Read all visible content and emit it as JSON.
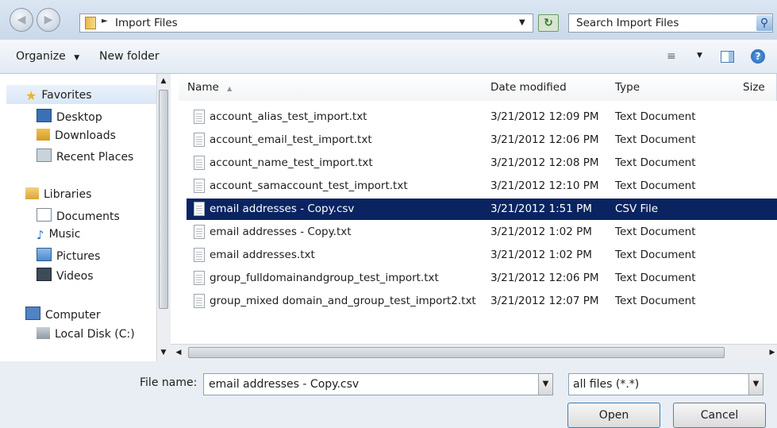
{
  "address_bar": {
    "path": "Import Files",
    "search_placeholder": "Search Import Files"
  },
  "toolbar": {
    "organize_label": "Organize",
    "new_folder_label": "New folder"
  },
  "nav_pane": {
    "favorites_label": "Favorites",
    "favorites": [
      "Desktop",
      "Downloads",
      "Recent Places"
    ],
    "libraries_label": "Libraries",
    "libraries": [
      "Documents",
      "Music",
      "Pictures",
      "Videos"
    ],
    "computer_label": "Computer",
    "computer": [
      "Local Disk (C:)"
    ]
  },
  "file_list": {
    "columns": [
      "Name",
      "Date modified",
      "Type",
      "Size"
    ],
    "rows": [
      {
        "name": "account_alias_test_import.txt",
        "date": "3/21/2012 12:09 PM",
        "type": "Text Document"
      },
      {
        "name": "account_email_test_import.txt",
        "date": "3/21/2012 12:06 PM",
        "type": "Text Document"
      },
      {
        "name": "account_name_test_import.txt",
        "date": "3/21/2012 12:08 PM",
        "type": "Text Document"
      },
      {
        "name": "account_samaccount_test_import.txt",
        "date": "3/21/2012 12:10 PM",
        "type": "Text Document"
      },
      {
        "name": "email addresses - Copy.csv",
        "date": "3/21/2012 1:51 PM",
        "type": "CSV File"
      },
      {
        "name": "email addresses - Copy.txt",
        "date": "3/21/2012 1:02 PM",
        "type": "Text Document"
      },
      {
        "name": "email addresses.txt",
        "date": "3/21/2012 1:02 PM",
        "type": "Text Document"
      },
      {
        "name": "group_fulldomainandgroup_test_import.txt",
        "date": "3/21/2012 12:06 PM",
        "type": "Text Document"
      },
      {
        "name": "group_mixed domain_and_group_test_import2.txt",
        "date": "3/21/2012 12:07 PM",
        "type": "Text Document"
      }
    ],
    "selected_index": 4
  },
  "footer": {
    "file_name_label": "File name:",
    "file_name_value": "email addresses - Copy.csv",
    "filter_value": "all files (*.*)",
    "open_label": "Open",
    "cancel_label": "Cancel"
  },
  "colors": {
    "selection": "#0a2462",
    "chrome": "#dbe6f2"
  }
}
